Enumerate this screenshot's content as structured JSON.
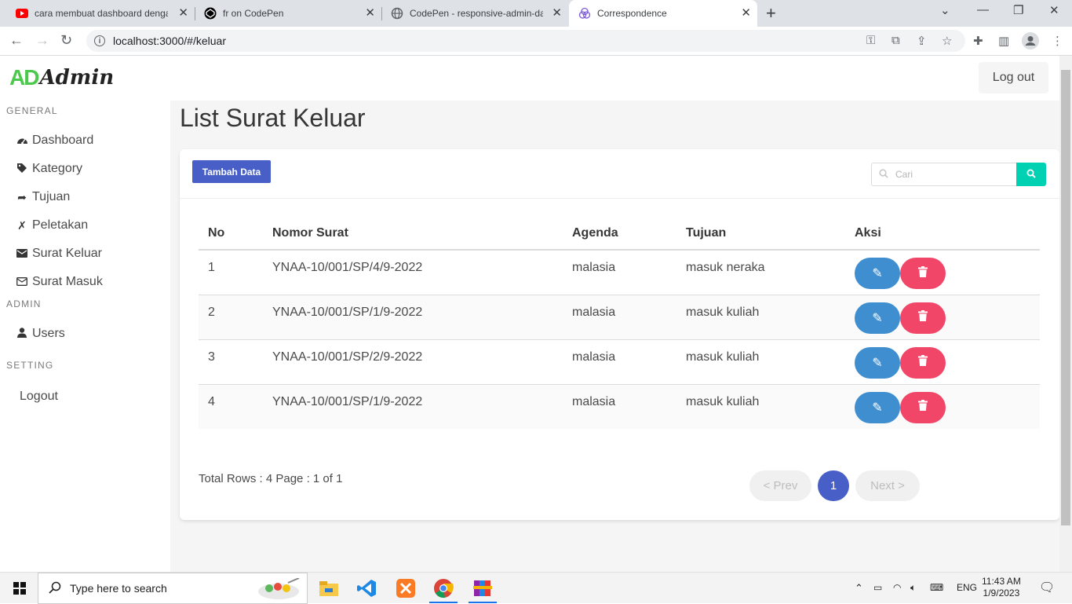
{
  "browser": {
    "tabs": [
      {
        "title": "cara membuat dashboard dengan",
        "active": false
      },
      {
        "title": "fr on CodePen",
        "active": false
      },
      {
        "title": "CodePen - responsive-admin-das",
        "active": false
      },
      {
        "title": "Correspondence",
        "active": true
      }
    ],
    "url": "localhost:3000/#/keluar"
  },
  "navbar": {
    "logo_mark": "AD",
    "logo_text": "Admin",
    "logout_label": "Log out"
  },
  "sidebar": {
    "sections": [
      {
        "label": "GENERAL"
      },
      {
        "label": "ADMIN"
      },
      {
        "label": "SETTING"
      }
    ],
    "items": [
      {
        "label": "Dashboard",
        "icon": "dashboard-icon"
      },
      {
        "label": "Kategory",
        "icon": "tag-icon"
      },
      {
        "label": "Tujuan",
        "icon": "share-icon"
      },
      {
        "label": "Peletakan",
        "icon": "xing-icon"
      },
      {
        "label": "Surat Keluar",
        "icon": "envelope-icon"
      },
      {
        "label": "Surat Masuk",
        "icon": "envelope-open-icon"
      },
      {
        "label": "Users",
        "icon": "user-icon"
      },
      {
        "label": "Logout",
        "icon": ""
      }
    ]
  },
  "main": {
    "title": "List Surat Keluar",
    "add_button": "Tambah Data",
    "search_placeholder": "Cari",
    "columns": [
      "No",
      "Nomor Surat",
      "Agenda",
      "Tujuan",
      "Aksi"
    ],
    "rows": [
      {
        "no": "1",
        "nomor": "YNAA-10/001/SP/4/9-2022",
        "agenda": "malasia",
        "tujuan": "masuk neraka"
      },
      {
        "no": "2",
        "nomor": "YNAA-10/001/SP/1/9-2022",
        "agenda": "malasia",
        "tujuan": "masuk kuliah"
      },
      {
        "no": "3",
        "nomor": "YNAA-10/001/SP/2/9-2022",
        "agenda": "malasia",
        "tujuan": "masuk kuliah"
      },
      {
        "no": "4",
        "nomor": "YNAA-10/001/SP/1/9-2022",
        "agenda": "malasia",
        "tujuan": "masuk kuliah"
      }
    ],
    "footer": "Total Rows : 4 Page : 1 of 1",
    "pagination": {
      "prev": "< Prev",
      "current": "1",
      "next": "Next >"
    }
  },
  "taskbar": {
    "search_placeholder": "Type here to search",
    "lang": "ENG",
    "time": "11:43 AM",
    "date": "1/9/2023"
  },
  "colors": {
    "primary": "#485fc7",
    "info": "#3e8ed0",
    "danger": "#f14668",
    "search_btn": "#00d1b2",
    "logo_green": "#4cc84c"
  }
}
